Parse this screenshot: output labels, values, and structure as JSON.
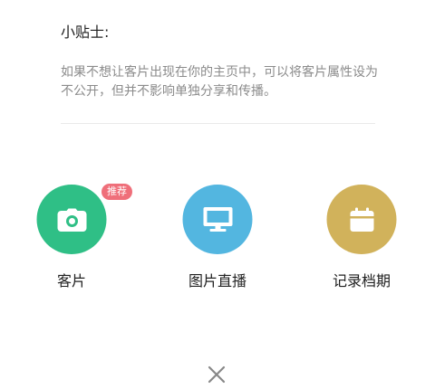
{
  "tips": {
    "title": "小贴士:",
    "body": "如果不想让客片出现在你的主页中，可以将客片属性设为不公开，但并不影响单独分享和传播。"
  },
  "actions": [
    {
      "label": "客片",
      "icon": "camera-icon",
      "color": "#2fbf86"
    },
    {
      "label": "图片直播",
      "icon": "monitor-icon",
      "color": "#53b6e0"
    },
    {
      "label": "记录档期",
      "icon": "calendar-icon",
      "color": "#d1b25b"
    }
  ],
  "badge": {
    "text": "推荐"
  },
  "close_icon": "close-icon"
}
